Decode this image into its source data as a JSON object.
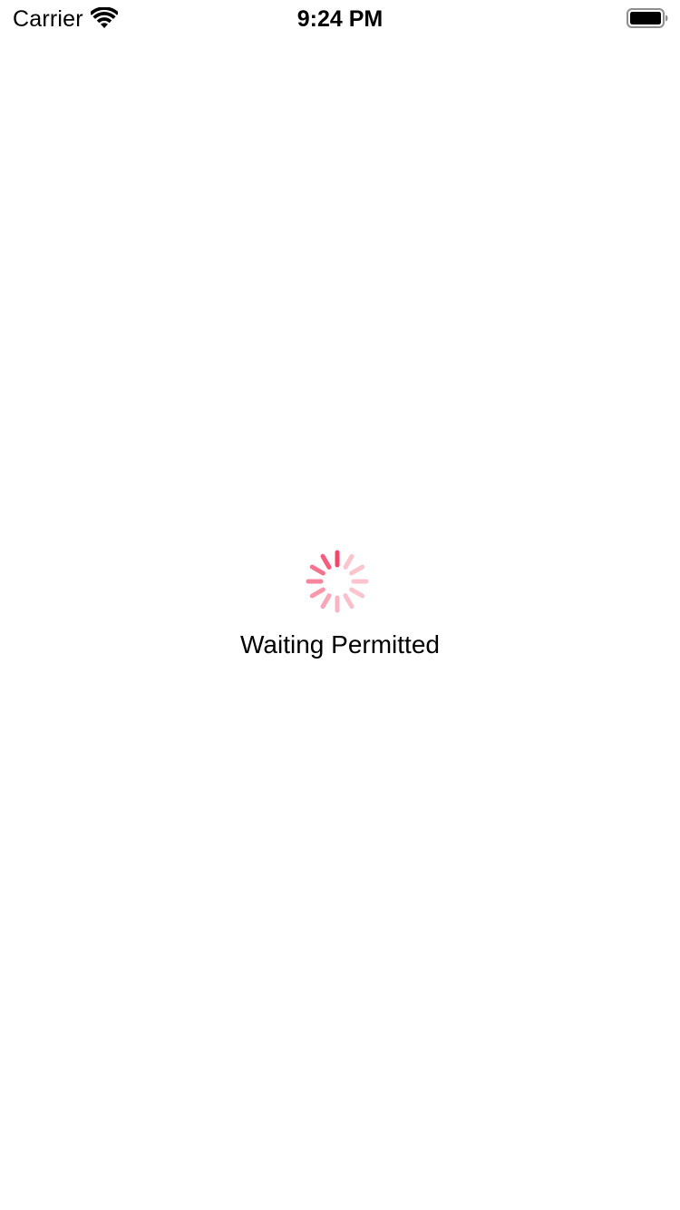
{
  "status_bar": {
    "carrier": "Carrier",
    "time": "9:24 PM",
    "wifi_icon": "wifi-icon",
    "battery_icon": "battery-full-icon"
  },
  "loader": {
    "spinner_icon": "activity-spinner-icon",
    "spinner_color": "#F2476A",
    "message": "Waiting Permitted"
  }
}
